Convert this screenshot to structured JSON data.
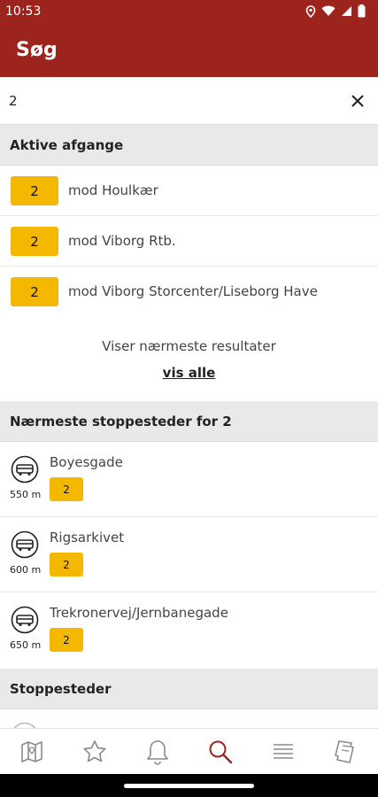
{
  "status_bar": {
    "time": "10:53"
  },
  "header": {
    "title": "Søg"
  },
  "search": {
    "value": "2",
    "placeholder": ""
  },
  "sections": {
    "active_departures": "Aktive afgange",
    "nearest_stops": "Nærmeste stoppesteder for 2",
    "stops": "Stoppesteder"
  },
  "departures": [
    {
      "line": "2",
      "destination": "mod Houlkær"
    },
    {
      "line": "2",
      "destination": "mod Viborg Rtb."
    },
    {
      "line": "2",
      "destination": "mod Viborg Storcenter/Liseborg Have"
    }
  ],
  "results_info": {
    "text": "Viser nærmeste resultater",
    "show_all": "vis alle"
  },
  "nearest_stops": [
    {
      "name": "Boyesgade",
      "distance": "550 m",
      "lines": [
        "2"
      ]
    },
    {
      "name": "Rigsarkivet",
      "distance": "600 m",
      "lines": [
        "2"
      ]
    },
    {
      "name": "Trekronervej/Jernbanegade",
      "distance": "650 m",
      "lines": [
        "2"
      ]
    }
  ],
  "bottom_nav": [
    {
      "name": "map-icon",
      "active": false
    },
    {
      "name": "star-icon",
      "active": false
    },
    {
      "name": "bell-icon",
      "active": false
    },
    {
      "name": "search-icon",
      "active": true
    },
    {
      "name": "menu-icon",
      "active": false
    },
    {
      "name": "tickets-icon",
      "active": false
    }
  ],
  "colors": {
    "brand": "#9d231d",
    "line_badge": "#f5b800",
    "section_bg": "#e9e9e9",
    "icon_gray": "#8a8a8a"
  }
}
